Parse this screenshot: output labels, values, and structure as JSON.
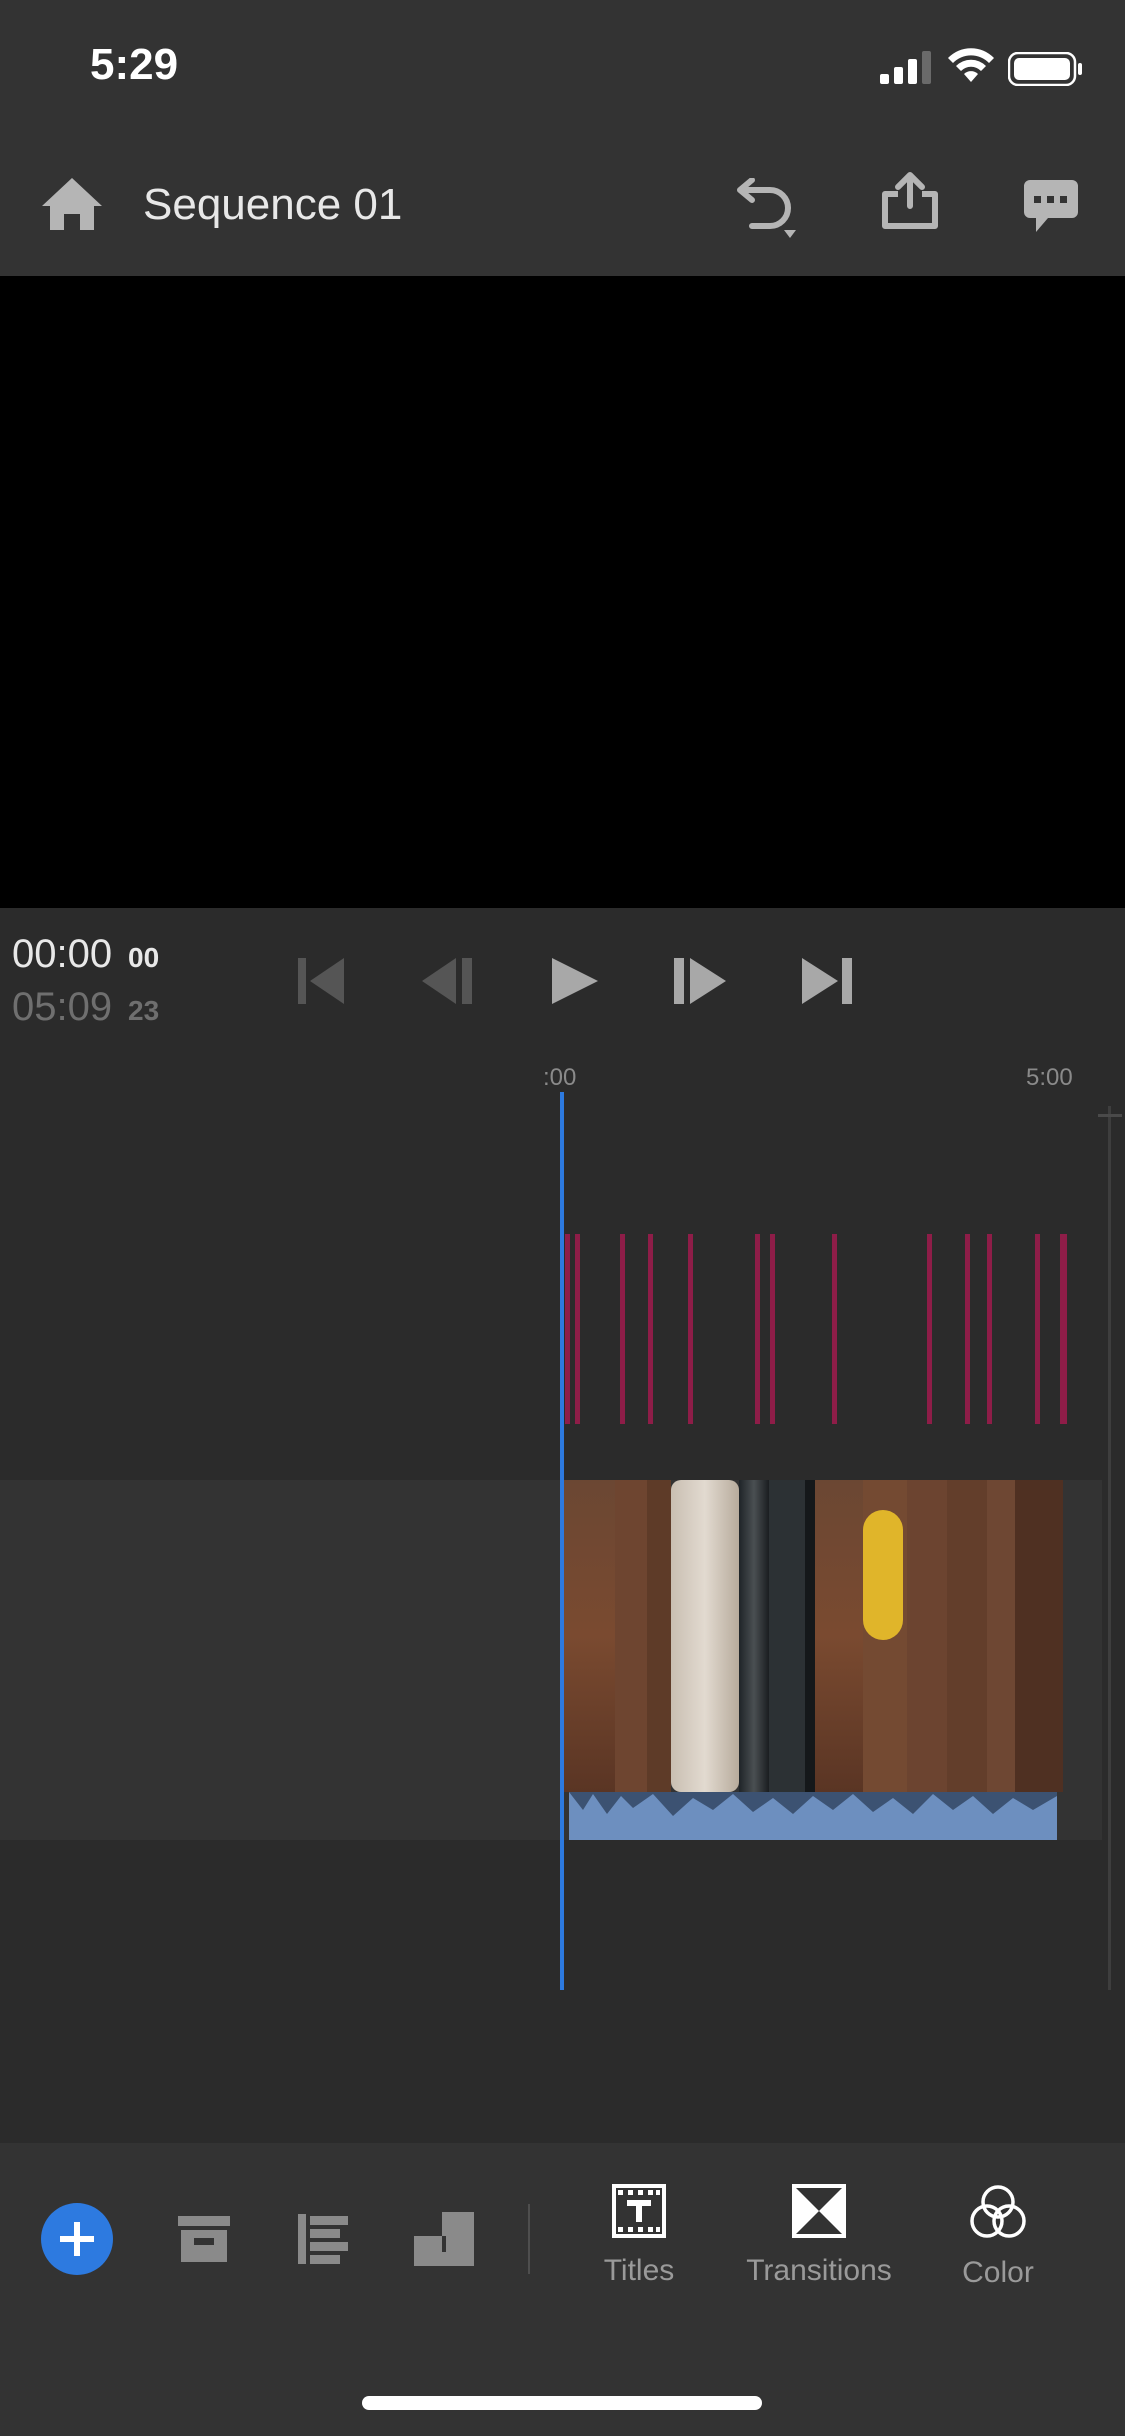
{
  "status_bar": {
    "time": "5:29"
  },
  "header": {
    "title": "Sequence 01"
  },
  "transport": {
    "current_tc": "00:00",
    "current_frames": "00",
    "total_tc": "05:09",
    "total_frames": "23"
  },
  "timeline": {
    "ruler_start": ":00",
    "ruler_end": "5:00",
    "marker_color": "#8e1d48",
    "playhead_color": "#2d7ae0"
  },
  "toolbar": {
    "titles_label": "Titles",
    "transitions_label": "Transitions",
    "color_label": "Color",
    "accent": "#2d7ae0"
  },
  "icons": {
    "status": [
      "signal-icon",
      "wifi-icon",
      "battery-icon"
    ],
    "header": [
      "home-icon",
      "undo-icon",
      "share-icon",
      "comment-icon"
    ],
    "transport": [
      "skip-to-start-icon",
      "step-back-icon",
      "play-icon",
      "step-forward-icon",
      "skip-to-end-icon"
    ],
    "toolbar": [
      "add-icon",
      "archive-icon",
      "align-icon",
      "crop-icon",
      "titles-icon",
      "transitions-icon",
      "color-icon"
    ]
  }
}
